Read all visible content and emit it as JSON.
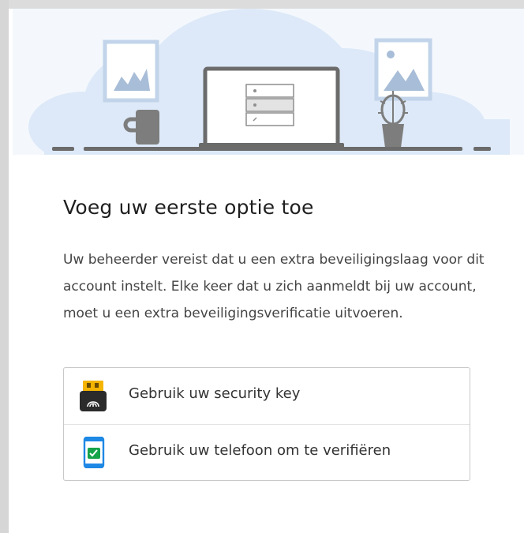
{
  "heading": "Voeg uw eerste optie toe",
  "description": "Uw beheerder vereist dat u een extra beveiligingslaag voor dit account instelt. Elke keer dat u zich aanmeldt bij uw account, moet u een extra beveiligingsverificatie uitvoeren.",
  "options": [
    {
      "label": "Gebruik uw security key",
      "icon": "security-key-icon"
    },
    {
      "label": "Gebruik uw telefoon om te verifiëren",
      "icon": "phone-check-icon"
    }
  ],
  "colors": {
    "hero_background": "#f4f8fd",
    "cloud": "#dde9f8",
    "illustration_gray": "#6b6b6b",
    "accent_green": "#16a34a",
    "key_gold": "#f4b400",
    "phone_blue": "#1e88e5"
  }
}
